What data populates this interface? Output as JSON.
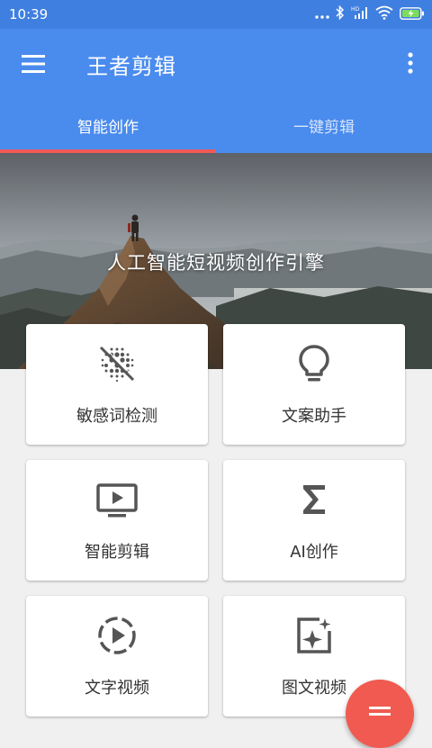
{
  "status_bar": {
    "time": "10:39",
    "icons": [
      "more-dots-icon",
      "bluetooth-icon",
      "signal-hd-icon",
      "wifi-icon",
      "battery-charging-icon"
    ]
  },
  "app_bar": {
    "title": "王者剪辑",
    "menu_icon": "hamburger-menu-icon",
    "more_icon": "more-vertical-icon"
  },
  "tabs": [
    {
      "label": "智能创作",
      "active": true
    },
    {
      "label": "一键剪辑",
      "active": false
    }
  ],
  "hero": {
    "caption": "人工智能短视频创作引擎"
  },
  "features": [
    {
      "label": "敏感词检测",
      "icon": "blur-off-icon"
    },
    {
      "label": "文案助手",
      "icon": "lightbulb-icon"
    },
    {
      "label": "智能剪辑",
      "icon": "tv-play-icon"
    },
    {
      "label": "AI创作",
      "icon": "sigma-icon"
    },
    {
      "label": "文字视频",
      "icon": "play-circle-dashed-icon"
    },
    {
      "label": "图文视频",
      "icon": "image-sparkle-icon"
    }
  ],
  "fab": {
    "icon": "menu-lines-icon"
  },
  "colors": {
    "primary": "#4a8bee",
    "status_bar": "#3f7fe0",
    "indicator": "#f05a58",
    "fab": "#f05a50",
    "icon_gray": "#555555"
  }
}
